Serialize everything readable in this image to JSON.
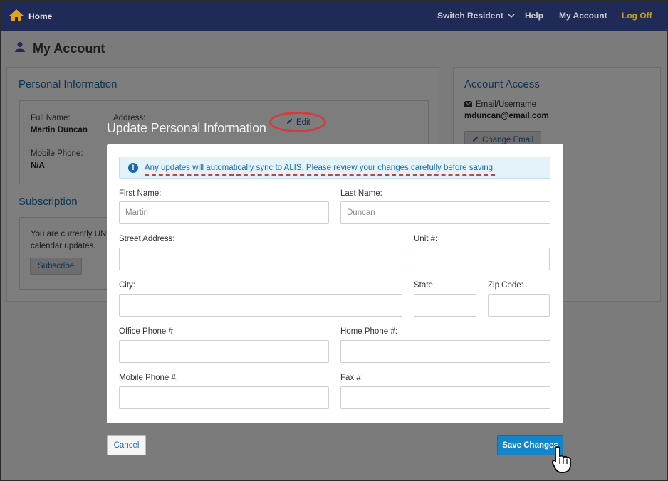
{
  "navbar": {
    "home_label": "Home",
    "switch_resident_label": "Switch Resident",
    "help_label": "Help",
    "my_account_label": "My Account",
    "log_off_label": "Log Off",
    "brand_color": "#1f2a57",
    "log_off_color": "#c99e16"
  },
  "page": {
    "title": "My Account"
  },
  "personal_info": {
    "heading": "Personal Information",
    "full_name_label": "Full Name:",
    "full_name": "Martin Duncan",
    "address_label": "Address:",
    "mobile_phone_label": "Mobile Phone:",
    "mobile_phone": "N/A",
    "edit_label": "Edit"
  },
  "subscription": {
    "heading": "Subscription",
    "text_line1": "You are currently UNS",
    "text_line2": "calendar updates.",
    "subscribe_label": "Subscribe"
  },
  "account_access": {
    "heading": "Account Access",
    "email_label": "Email/Username",
    "email": "mduncan@email.com",
    "change_email_label": "Change Email"
  },
  "modal": {
    "title": "Update Personal Information",
    "alert": "Any updates will automatically sync to ALIS. Please review your changes carefully before saving.",
    "fields": {
      "first_name_label": "First Name:",
      "first_name_placeholder": "Martin",
      "last_name_label": "Last Name:",
      "last_name_placeholder": "Duncan",
      "street_label": "Street Address:",
      "unit_label": "Unit #:",
      "city_label": "City:",
      "state_label": "State:",
      "zip_label": "Zip Code:",
      "office_phone_label": "Office Phone #:",
      "home_phone_label": "Home Phone #:",
      "mobile_phone_label": "Mobile Phone #:",
      "fax_label": "Fax #:"
    },
    "cancel_label": "Cancel",
    "save_label": "Save Changes",
    "accent_color": "#1485c8"
  }
}
